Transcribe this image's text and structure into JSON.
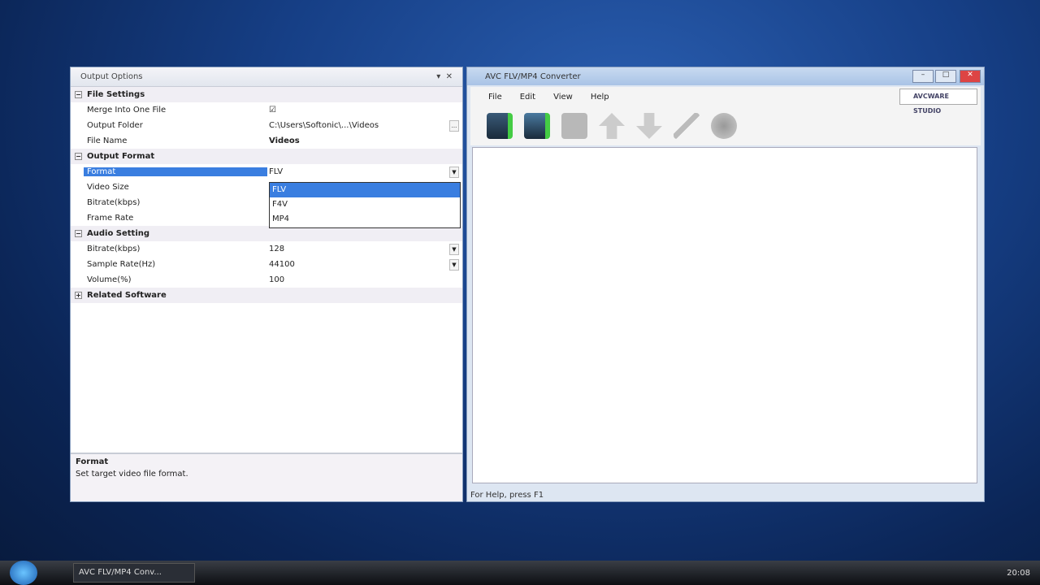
{
  "panel": {
    "title": "Output Options",
    "pin": "▾",
    "close": "✕",
    "cat1": "File Settings",
    "merge": "Merge Into One File",
    "merge_val": "☑",
    "folder": "Output Folder",
    "folder_val": "C:\\Users\\Softonic\\...\\Videos",
    "browse": "...",
    "fname": "File Name",
    "fname_val": "Videos",
    "cat2": "Output Format",
    "format": "Format",
    "format_val": "FLV",
    "vsize": "Video Size",
    "vbitrate": "Bitrate(kbps)",
    "frate": "Frame Rate",
    "options": [
      "FLV",
      "F4V",
      "MP4"
    ],
    "cat3": "Audio Setting",
    "abitrate": "Bitrate(kbps)",
    "abitrate_val": "128",
    "srate": "Sample Rate(Hz)",
    "srate_val": "44100",
    "volume": "Volume(%)",
    "volume_val": "100",
    "cat4": "Related Software",
    "desc_title": "Format",
    "desc_text": "Set target video file format."
  },
  "app": {
    "title": "AVC FLV/MP4 Converter",
    "menu": [
      "File",
      "Edit",
      "View",
      "Help"
    ],
    "logo": "AVCWARE STUDIO",
    "status": "For Help, press F1",
    "min": "–",
    "max": "□",
    "close": "✕"
  },
  "taskbar": {
    "task": "AVC FLV/MP4 Conv...",
    "clock": "20:08"
  }
}
